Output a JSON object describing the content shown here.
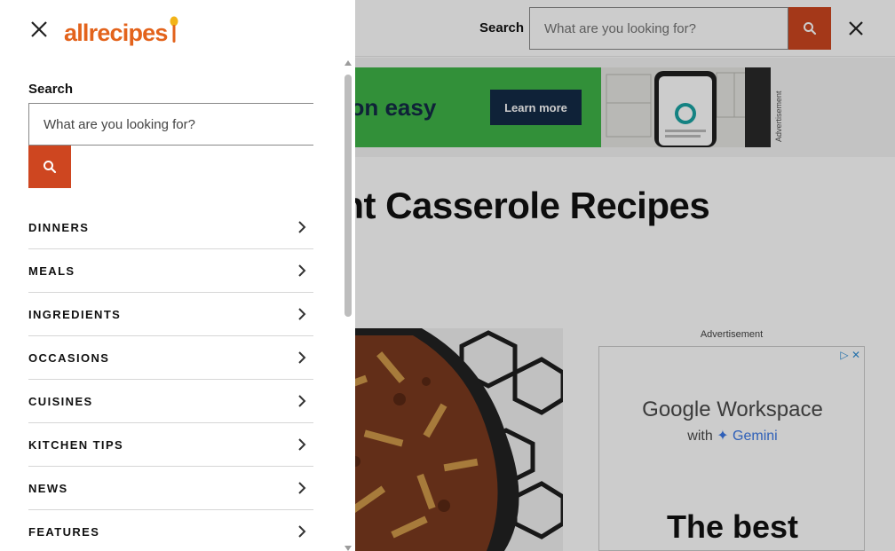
{
  "header": {
    "search_label": "Search",
    "search_placeholder": "What are you looking for?"
  },
  "banner_ad": {
    "text": "son easy",
    "button": "Learn more",
    "side_label": "Advertisement"
  },
  "page": {
    "headline": "knight Casserole Recipes"
  },
  "side_ad": {
    "label": "Advertisement",
    "title": "Google Workspace",
    "subtitle_prefix": "with ",
    "subtitle_brand": "✦ Gemini",
    "big_text": "The best"
  },
  "drawer": {
    "logo": "allrecipes",
    "search_label": "Search",
    "search_placeholder": "What are you looking for?",
    "nav": [
      {
        "label": "DINNERS"
      },
      {
        "label": "MEALS"
      },
      {
        "label": "INGREDIENTS"
      },
      {
        "label": "OCCASIONS"
      },
      {
        "label": "CUISINES"
      },
      {
        "label": "KITCHEN TIPS"
      },
      {
        "label": "NEWS"
      },
      {
        "label": "FEATURES"
      }
    ]
  },
  "colors": {
    "brand": "#e3631c",
    "search_button": "#ce4620",
    "ad_green": "#3fb548",
    "ad_navy": "#132b46"
  },
  "icons": {
    "close": "close-icon",
    "search": "search-icon",
    "chevron": "chevron-right-icon",
    "logo_mark": "spoon-icon"
  }
}
